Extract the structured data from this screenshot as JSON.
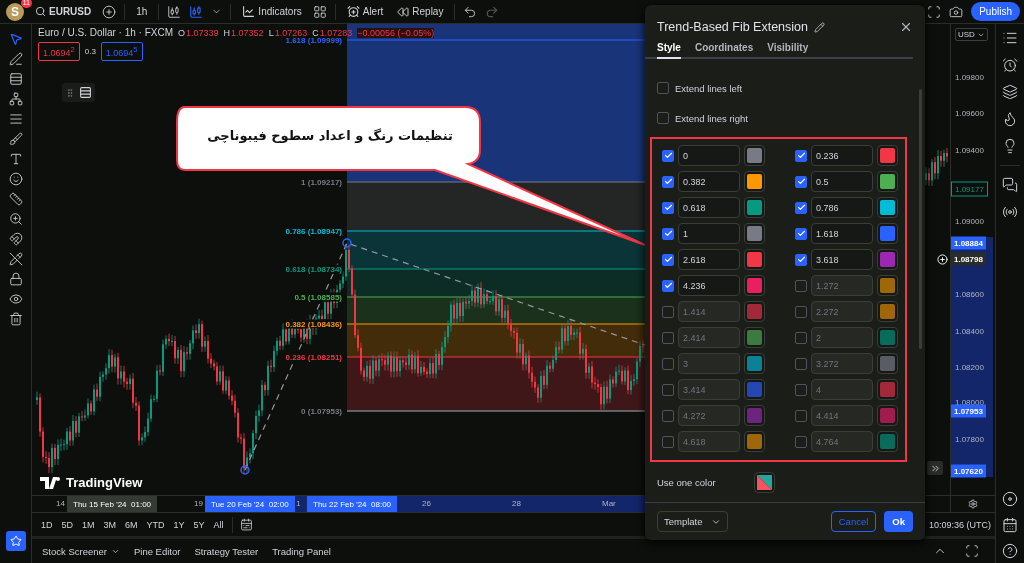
{
  "top_bar": {
    "avatar": "S",
    "badge": "11",
    "symbol": "EURUSD",
    "interval": "1h",
    "indicators": "Indicators",
    "alert": "Alert",
    "replay": "Replay",
    "publish": "Publish"
  },
  "legend": {
    "title": "Euro / U.S. Dollar · 1h · FXCM",
    "ohlc": [
      {
        "key": "O",
        "value": "1.07339"
      },
      {
        "key": "H",
        "value": "1.07352"
      },
      {
        "key": "L",
        "value": "1.07263"
      },
      {
        "key": "C",
        "value": "1.07283"
      }
    ],
    "change": "−0.00056 (−0.05%)",
    "bid": "1.0694$^{2}$",
    "spread": "0.3",
    "ask": "1.0694$^{5}$"
  },
  "fib_levels": [
    {
      "label": "1.618 (1.09999)",
      "color": "#2962ff"
    },
    {
      "label": "1 (1.09217)",
      "color": "#787b86"
    },
    {
      "label": "0.786 (1.08947)",
      "color": "#00bcd4"
    },
    {
      "label": "0.618 (1.08734)",
      "color": "#089981"
    },
    {
      "label": "0.5 (1.08585)",
      "color": "#4caf50"
    },
    {
      "label": "0.382 (1.08436)",
      "color": "#ff9800"
    },
    {
      "label": "0.236 (1.08251)",
      "color": "#f23645"
    },
    {
      "label": "0 (1.07953)",
      "color": "#787b86"
    }
  ],
  "chart_logo": "TradingView",
  "callout": "تنظیمات رنگ و اعداد سطوح فیبوناچی",
  "price_axis": {
    "currency": "USD",
    "ticks": [
      "1.09800",
      "1.09600",
      "1.09400",
      "1.09000",
      "1.08600",
      "1.08400",
      "1.08200",
      "1.08000",
      "1.07800"
    ],
    "markers": [
      {
        "label": "1.09177",
        "kind": "last"
      },
      {
        "label": "1.08884",
        "kind": "range"
      },
      {
        "label": "1.08798",
        "kind": "crosshair"
      },
      {
        "label": "1.07953",
        "kind": "range"
      },
      {
        "label": "1.07620",
        "kind": "range"
      }
    ]
  },
  "time_axis": {
    "ticks": [
      "14",
      "19",
      "1",
      "26",
      "28",
      "Mar"
    ],
    "markers": [
      {
        "label": "Thu 15 Feb '24  01:00",
        "kind": "crosshair"
      },
      {
        "label": "Tue 20 Feb '24  02:00",
        "kind": "range"
      },
      {
        "label": "Thu 22 Feb '24  08:00",
        "kind": "range"
      }
    ]
  },
  "range_bar": {
    "ranges": [
      "1D",
      "5D",
      "1M",
      "3M",
      "6M",
      "YTD",
      "1Y",
      "5Y",
      "All"
    ],
    "time": "10:09:36 (UTC)"
  },
  "bottom_tabs": [
    {
      "label": "Stock Screener",
      "has_menu": true
    },
    {
      "label": "Pine Editor",
      "has_menu": false
    },
    {
      "label": "Strategy Tester",
      "has_menu": false
    },
    {
      "label": "Trading Panel",
      "has_menu": false
    }
  ],
  "dialog": {
    "title": "Trend-Based Fib Extension",
    "tabs": [
      {
        "label": "Style",
        "selected": true
      },
      {
        "label": "Coordinates",
        "selected": false
      },
      {
        "label": "Visibility",
        "selected": false
      }
    ],
    "options": [
      {
        "label": "Extend lines left",
        "checked": false
      },
      {
        "label": "Extend lines right",
        "checked": false
      }
    ],
    "levels": [
      {
        "value": "0",
        "checked": true,
        "color": "#787b86"
      },
      {
        "value": "0.236",
        "checked": true,
        "color": "#f23645"
      },
      {
        "value": "0.382",
        "checked": true,
        "color": "#ff9800"
      },
      {
        "value": "0.5",
        "checked": true,
        "color": "#4caf50"
      },
      {
        "value": "0.618",
        "checked": true,
        "color": "#089981"
      },
      {
        "value": "0.786",
        "checked": true,
        "color": "#00bcd4"
      },
      {
        "value": "1",
        "checked": true,
        "color": "#787b86"
      },
      {
        "value": "1.618",
        "checked": true,
        "color": "#2962ff"
      },
      {
        "value": "2.618",
        "checked": true,
        "color": "#f23645"
      },
      {
        "value": "3.618",
        "checked": true,
        "color": "#9c27b0"
      },
      {
        "value": "4.236",
        "checked": true,
        "color": "#e91e63"
      },
      {
        "value": "1.272",
        "checked": false,
        "color": "#a0660a"
      },
      {
        "value": "1.414",
        "checked": false,
        "color": "#a3293a"
      },
      {
        "value": "2.272",
        "checked": false,
        "color": "#a0660a"
      },
      {
        "value": "2.414",
        "checked": false,
        "color": "#3d7a3f"
      },
      {
        "value": "2",
        "checked": false,
        "color": "#0a6b5c"
      },
      {
        "value": "3",
        "checked": false,
        "color": "#0a8197"
      },
      {
        "value": "3.272",
        "checked": false,
        "color": "#5a5c64"
      },
      {
        "value": "3.414",
        "checked": false,
        "color": "#2547b5"
      },
      {
        "value": "4",
        "checked": false,
        "color": "#a3293a"
      },
      {
        "value": "4.272",
        "checked": false,
        "color": "#6e237e"
      },
      {
        "value": "4.414",
        "checked": false,
        "color": "#a01c4c"
      },
      {
        "value": "4.618",
        "checked": false,
        "color": "#a0660a"
      },
      {
        "value": "4.764",
        "checked": false,
        "color": "#0a6b5c"
      }
    ],
    "one_color_label": "Use one color",
    "template": "Template",
    "cancel": "Cancel",
    "ok": "Ok"
  }
}
